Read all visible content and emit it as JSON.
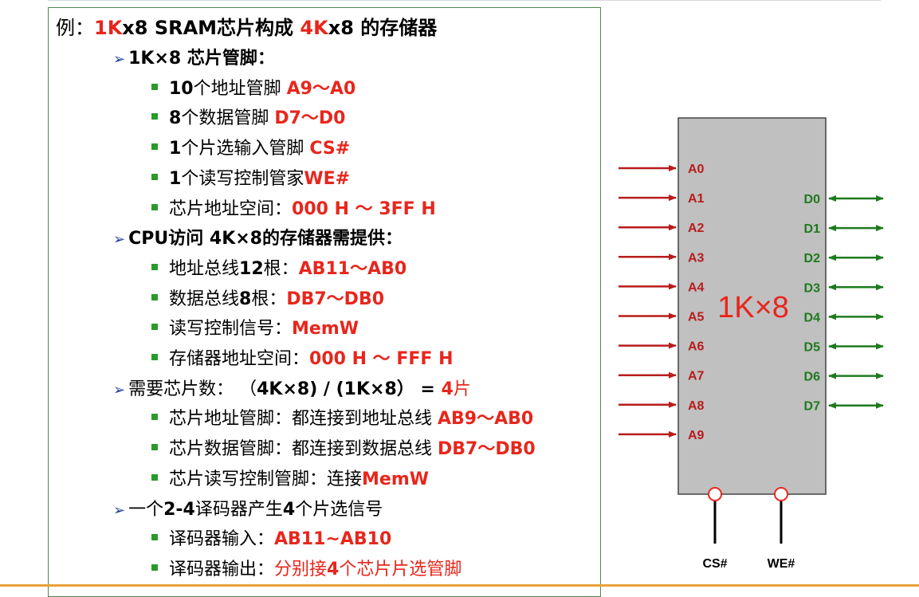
{
  "title": {
    "p1": "例：",
    "r1": "1K",
    "p2": "x8 SRAM芯片构成 ",
    "r2": "4K",
    "p3": "x8 的存储器"
  },
  "items": [
    {
      "level": 1,
      "parts": [
        [
          "b",
          "1K×8 芯片管脚："
        ]
      ]
    },
    {
      "level": 2,
      "parts": [
        [
          "b",
          "10"
        ],
        [
          "n",
          "个地址管脚 "
        ],
        [
          "r",
          "A9～A0"
        ]
      ]
    },
    {
      "level": 2,
      "parts": [
        [
          "b",
          "8"
        ],
        [
          "n",
          "个数据管脚 "
        ],
        [
          "r",
          "D7～D0"
        ]
      ]
    },
    {
      "level": 2,
      "parts": [
        [
          "b",
          "1"
        ],
        [
          "n",
          "个片选输入管脚 "
        ],
        [
          "r",
          "CS#"
        ]
      ]
    },
    {
      "level": 2,
      "parts": [
        [
          "b",
          "1"
        ],
        [
          "n",
          "个读写控制管家"
        ],
        [
          "r",
          "WE#"
        ]
      ]
    },
    {
      "level": 2,
      "parts": [
        [
          "n",
          "芯片地址空间："
        ],
        [
          "r",
          "000 H ～ 3FF H"
        ]
      ]
    },
    {
      "level": 1,
      "parts": [
        [
          "b",
          "CPU访问 4K×8的存储器需提供："
        ]
      ]
    },
    {
      "level": 2,
      "parts": [
        [
          "n",
          "地址总线"
        ],
        [
          "b",
          "12"
        ],
        [
          "n",
          "根："
        ],
        [
          "r",
          "AB11～AB0"
        ]
      ]
    },
    {
      "level": 2,
      "parts": [
        [
          "n",
          "数据总线"
        ],
        [
          "b",
          "8"
        ],
        [
          "n",
          "根："
        ],
        [
          "r",
          "DB7～DB0"
        ]
      ]
    },
    {
      "level": 2,
      "parts": [
        [
          "n",
          "读写控制信号："
        ],
        [
          "r",
          "MemW"
        ]
      ]
    },
    {
      "level": 2,
      "parts": [
        [
          "n",
          "存储器地址空间："
        ],
        [
          "r",
          "000 H ～ FFF H"
        ]
      ]
    },
    {
      "level": 1,
      "parts": [
        [
          "n",
          "需要芯片数： （"
        ],
        [
          "b",
          "4K×8) / (1K×8） = "
        ],
        [
          "r",
          "4"
        ],
        [
          "rn",
          "片"
        ]
      ]
    },
    {
      "level": 2,
      "parts": [
        [
          "n",
          "芯片地址管脚：都连接到地址总线 "
        ],
        [
          "r",
          "AB9～AB0"
        ]
      ]
    },
    {
      "level": 2,
      "parts": [
        [
          "n",
          "芯片数据管脚：都连接到数据总线 "
        ],
        [
          "r",
          "DB7～DB0"
        ]
      ]
    },
    {
      "level": 2,
      "parts": [
        [
          "n",
          "芯片读写控制管脚：连接"
        ],
        [
          "r",
          "MemW"
        ]
      ]
    },
    {
      "level": 1,
      "parts": [
        [
          "n",
          "一个"
        ],
        [
          "b",
          "2-4"
        ],
        [
          "n",
          "译码器产生"
        ],
        [
          "b",
          "4"
        ],
        [
          "n",
          "个片选信号"
        ]
      ]
    },
    {
      "level": 2,
      "parts": [
        [
          "n",
          "译码器输入："
        ],
        [
          "r",
          "AB11~AB10"
        ]
      ]
    },
    {
      "level": 2,
      "parts": [
        [
          "n",
          "译码器输出："
        ],
        [
          "rn",
          "分别接"
        ],
        [
          "r",
          "4"
        ],
        [
          "rn",
          "个芯片片选管脚"
        ]
      ]
    }
  ],
  "chip": {
    "label": "1K×8",
    "address_pins": [
      "A0",
      "A1",
      "A2",
      "A3",
      "A4",
      "A5",
      "A6",
      "A7",
      "A8",
      "A9"
    ],
    "data_pins": [
      "D0",
      "D1",
      "D2",
      "D3",
      "D4",
      "D5",
      "D6",
      "D7"
    ],
    "control_pins": [
      "CS#",
      "WE#"
    ]
  },
  "colors": {
    "address": "#b81c1c",
    "data": "#1e7a1e",
    "chip_fill": "#c0c0c0",
    "highlight": "#e8261c"
  }
}
